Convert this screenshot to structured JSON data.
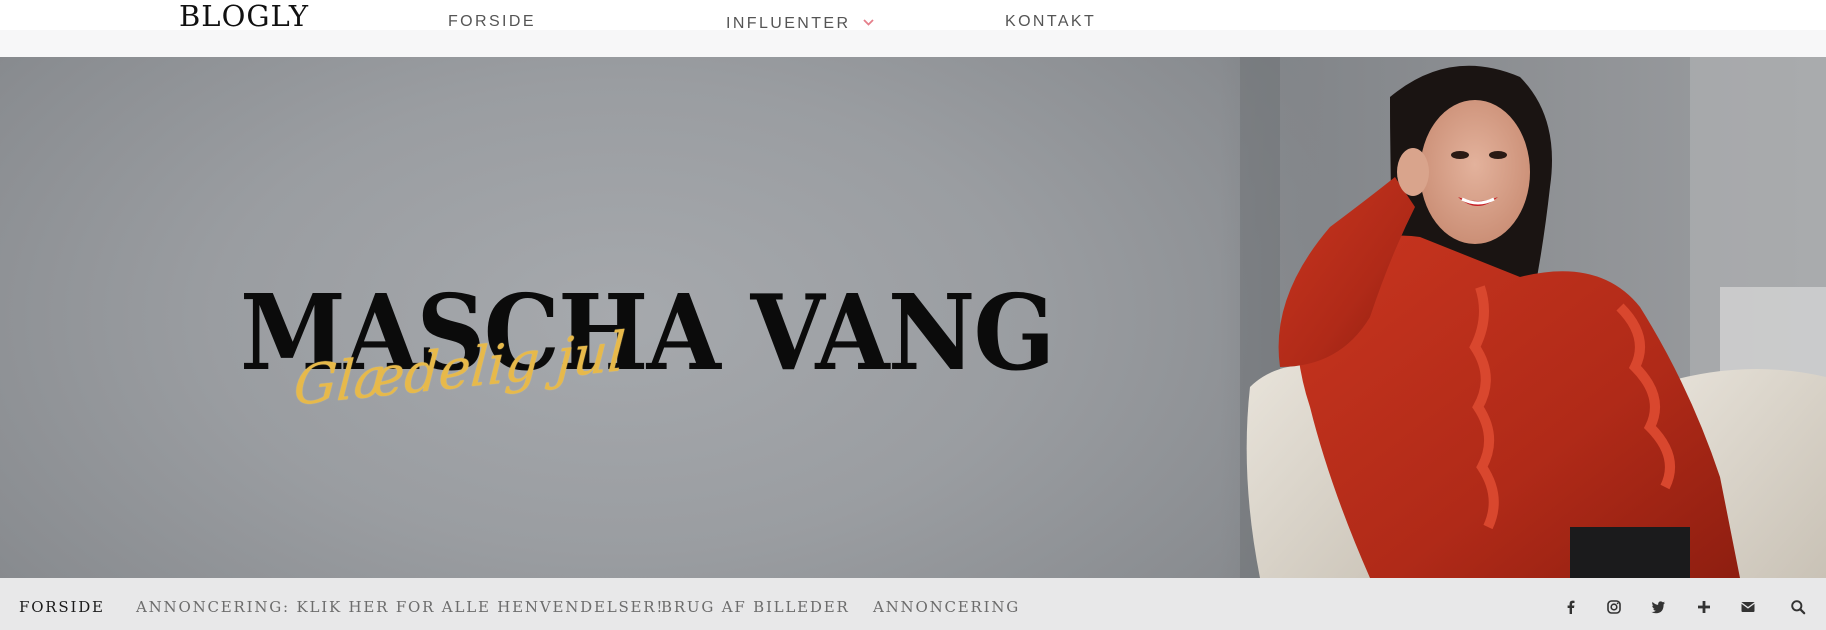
{
  "header": {
    "logo": "BLOGLY",
    "nav": [
      {
        "label": "FORSIDE"
      },
      {
        "label": "INFLUENTER",
        "has_dropdown": true
      },
      {
        "label": "KONTAKT"
      }
    ]
  },
  "hero": {
    "title": "MASCHA VANG",
    "script_text": "Glædelig jul"
  },
  "bottom_nav": {
    "items": [
      {
        "label": "FORSIDE"
      },
      {
        "label": "ANNONCERING: KLIK HER FOR ALLE HENVENDELSER!"
      },
      {
        "label": "BRUG AF BILLEDER"
      },
      {
        "label": "ANNONCERING"
      }
    ],
    "icons": [
      "facebook-icon",
      "instagram-icon",
      "twitter-icon",
      "plus-icon",
      "mail-icon",
      "search-icon"
    ]
  },
  "colors": {
    "accent": "#e57f8b",
    "script_gold": "#e7b94a",
    "hero_gray": "#9a9da1",
    "bottom_bar": "#e8e8e9"
  }
}
